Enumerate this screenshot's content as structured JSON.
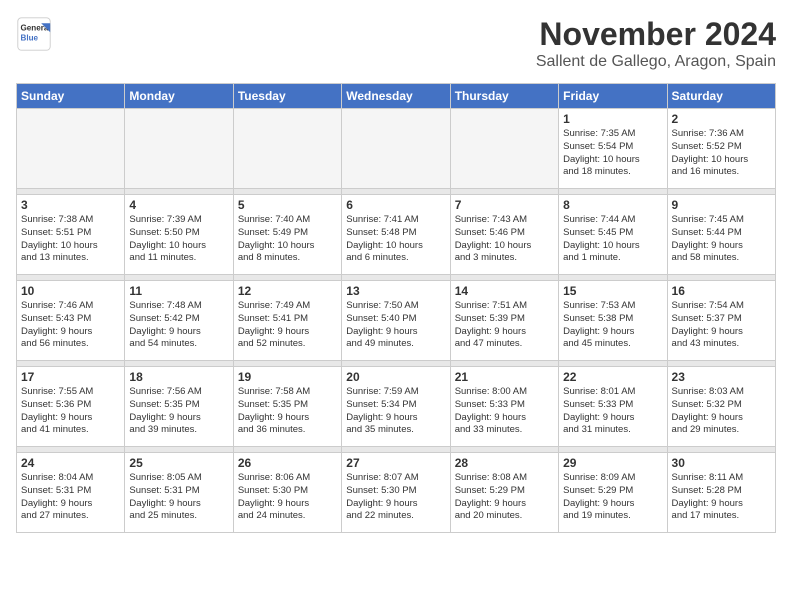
{
  "logo": {
    "line1": "General",
    "line2": "Blue"
  },
  "title": "November 2024",
  "location": "Sallent de Gallego, Aragon, Spain",
  "days_header": [
    "Sunday",
    "Monday",
    "Tuesday",
    "Wednesday",
    "Thursday",
    "Friday",
    "Saturday"
  ],
  "weeks": [
    [
      {
        "day": "",
        "info": ""
      },
      {
        "day": "",
        "info": ""
      },
      {
        "day": "",
        "info": ""
      },
      {
        "day": "",
        "info": ""
      },
      {
        "day": "",
        "info": ""
      },
      {
        "day": "1",
        "info": "Sunrise: 7:35 AM\nSunset: 5:54 PM\nDaylight: 10 hours\nand 18 minutes."
      },
      {
        "day": "2",
        "info": "Sunrise: 7:36 AM\nSunset: 5:52 PM\nDaylight: 10 hours\nand 16 minutes."
      }
    ],
    [
      {
        "day": "3",
        "info": "Sunrise: 7:38 AM\nSunset: 5:51 PM\nDaylight: 10 hours\nand 13 minutes."
      },
      {
        "day": "4",
        "info": "Sunrise: 7:39 AM\nSunset: 5:50 PM\nDaylight: 10 hours\nand 11 minutes."
      },
      {
        "day": "5",
        "info": "Sunrise: 7:40 AM\nSunset: 5:49 PM\nDaylight: 10 hours\nand 8 minutes."
      },
      {
        "day": "6",
        "info": "Sunrise: 7:41 AM\nSunset: 5:48 PM\nDaylight: 10 hours\nand 6 minutes."
      },
      {
        "day": "7",
        "info": "Sunrise: 7:43 AM\nSunset: 5:46 PM\nDaylight: 10 hours\nand 3 minutes."
      },
      {
        "day": "8",
        "info": "Sunrise: 7:44 AM\nSunset: 5:45 PM\nDaylight: 10 hours\nand 1 minute."
      },
      {
        "day": "9",
        "info": "Sunrise: 7:45 AM\nSunset: 5:44 PM\nDaylight: 9 hours\nand 58 minutes."
      }
    ],
    [
      {
        "day": "10",
        "info": "Sunrise: 7:46 AM\nSunset: 5:43 PM\nDaylight: 9 hours\nand 56 minutes."
      },
      {
        "day": "11",
        "info": "Sunrise: 7:48 AM\nSunset: 5:42 PM\nDaylight: 9 hours\nand 54 minutes."
      },
      {
        "day": "12",
        "info": "Sunrise: 7:49 AM\nSunset: 5:41 PM\nDaylight: 9 hours\nand 52 minutes."
      },
      {
        "day": "13",
        "info": "Sunrise: 7:50 AM\nSunset: 5:40 PM\nDaylight: 9 hours\nand 49 minutes."
      },
      {
        "day": "14",
        "info": "Sunrise: 7:51 AM\nSunset: 5:39 PM\nDaylight: 9 hours\nand 47 minutes."
      },
      {
        "day": "15",
        "info": "Sunrise: 7:53 AM\nSunset: 5:38 PM\nDaylight: 9 hours\nand 45 minutes."
      },
      {
        "day": "16",
        "info": "Sunrise: 7:54 AM\nSunset: 5:37 PM\nDaylight: 9 hours\nand 43 minutes."
      }
    ],
    [
      {
        "day": "17",
        "info": "Sunrise: 7:55 AM\nSunset: 5:36 PM\nDaylight: 9 hours\nand 41 minutes."
      },
      {
        "day": "18",
        "info": "Sunrise: 7:56 AM\nSunset: 5:35 PM\nDaylight: 9 hours\nand 39 minutes."
      },
      {
        "day": "19",
        "info": "Sunrise: 7:58 AM\nSunset: 5:35 PM\nDaylight: 9 hours\nand 36 minutes."
      },
      {
        "day": "20",
        "info": "Sunrise: 7:59 AM\nSunset: 5:34 PM\nDaylight: 9 hours\nand 35 minutes."
      },
      {
        "day": "21",
        "info": "Sunrise: 8:00 AM\nSunset: 5:33 PM\nDaylight: 9 hours\nand 33 minutes."
      },
      {
        "day": "22",
        "info": "Sunrise: 8:01 AM\nSunset: 5:33 PM\nDaylight: 9 hours\nand 31 minutes."
      },
      {
        "day": "23",
        "info": "Sunrise: 8:03 AM\nSunset: 5:32 PM\nDaylight: 9 hours\nand 29 minutes."
      }
    ],
    [
      {
        "day": "24",
        "info": "Sunrise: 8:04 AM\nSunset: 5:31 PM\nDaylight: 9 hours\nand 27 minutes."
      },
      {
        "day": "25",
        "info": "Sunrise: 8:05 AM\nSunset: 5:31 PM\nDaylight: 9 hours\nand 25 minutes."
      },
      {
        "day": "26",
        "info": "Sunrise: 8:06 AM\nSunset: 5:30 PM\nDaylight: 9 hours\nand 24 minutes."
      },
      {
        "day": "27",
        "info": "Sunrise: 8:07 AM\nSunset: 5:30 PM\nDaylight: 9 hours\nand 22 minutes."
      },
      {
        "day": "28",
        "info": "Sunrise: 8:08 AM\nSunset: 5:29 PM\nDaylight: 9 hours\nand 20 minutes."
      },
      {
        "day": "29",
        "info": "Sunrise: 8:09 AM\nSunset: 5:29 PM\nDaylight: 9 hours\nand 19 minutes."
      },
      {
        "day": "30",
        "info": "Sunrise: 8:11 AM\nSunset: 5:28 PM\nDaylight: 9 hours\nand 17 minutes."
      }
    ]
  ]
}
